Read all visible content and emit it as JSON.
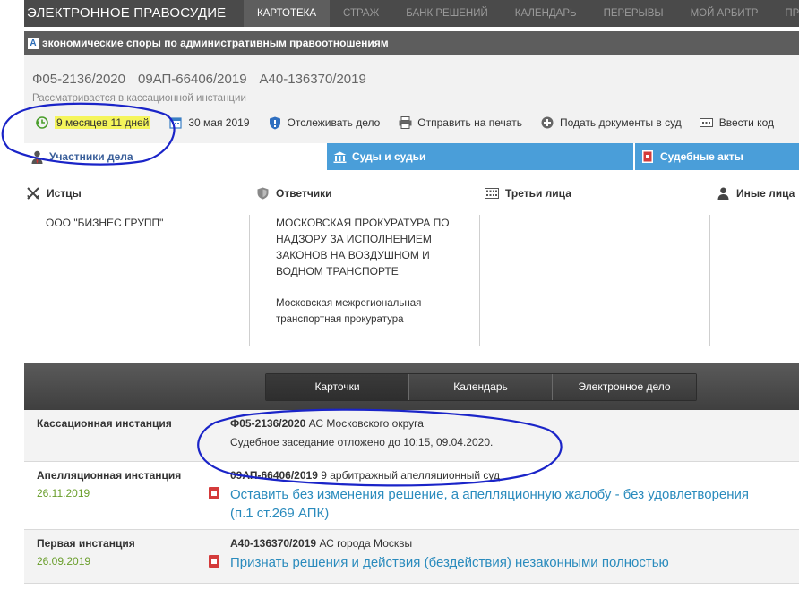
{
  "topbar": {
    "brand": "ЭЛЕКТРОННОЕ ПРАВОСУДИЕ",
    "nav": [
      {
        "label": "КАРТОТЕКА",
        "active": true
      },
      {
        "label": "СТРАЖ",
        "active": false
      },
      {
        "label": "БАНК РЕШЕНИЙ",
        "active": false
      },
      {
        "label": "КАЛЕНДАРЬ",
        "active": false
      },
      {
        "label": "ПЕРЕРЫВЫ",
        "active": false
      },
      {
        "label": "МОЙ АРБИТР",
        "active": false
      },
      {
        "label": "ПРО",
        "active": false
      }
    ]
  },
  "category": {
    "icon_letter": "A",
    "text": "экономические споры по административным правоотношениям"
  },
  "case": {
    "numbers": [
      "Ф05-2136/2020",
      "09АП-66406/2019",
      "А40-136370/2019"
    ],
    "status": "Рассматривается в кассационной инстанции",
    "actions": {
      "duration": "9 месяцев 11 дней",
      "date": "30 мая 2019",
      "track": "Отслеживать дело",
      "print": "Отправить на печать",
      "submit": "Подать документы в суд",
      "code": "Ввести код"
    }
  },
  "tabs": {
    "participants": "Участники дела",
    "courts": "Суды и судьи",
    "acts": "Судебные акты"
  },
  "participants": {
    "plaintiffs": {
      "title": "Истцы",
      "items": [
        "ООО \"БИЗНЕС ГРУПП\""
      ]
    },
    "defendants": {
      "title": "Ответчики",
      "items": [
        [
          "МОСКОВСКАЯ ПРОКУРАТУРА ПО",
          "НАДЗОРУ ЗА ИСПОЛНЕНИЕМ",
          "ЗАКОНОВ НА ВОЗДУШНОМ И",
          "ВОДНОМ ТРАНСПОРТЕ"
        ],
        [
          "Московская межрегиональная",
          "транспортная прокуратура"
        ]
      ]
    },
    "third_parties": {
      "title": "Третьи лица"
    },
    "others": {
      "title": "Иные лица"
    }
  },
  "segments": [
    "Карточки",
    "Календарь",
    "Электронное дело"
  ],
  "instances": [
    {
      "name": "Кассационная инстанция",
      "date": "",
      "case_no": "Ф05-2136/2020",
      "court": "АС Московского округа",
      "note": "Судебное заседание отложено до 10:15, 09.04.2020."
    },
    {
      "name": "Апелляционная инстанция",
      "date": "26.11.2019",
      "case_no": "09АП-66406/2019",
      "court": "9 арбитражный апелляционный суд",
      "link_lines": [
        "Оставить без изменения решение, а апелляционную жалобу - без удовлетворения",
        "(п.1 ст.269 АПК)"
      ]
    },
    {
      "name": "Первая инстанция",
      "date": "26.09.2019",
      "case_no": "А40-136370/2019",
      "court": "АС города Москвы",
      "link_lines": [
        "Признать решения и действия (бездействия) незаконными полностью"
      ]
    }
  ],
  "colors": {
    "topbar": "#4a4a4a",
    "tab_blue": "#4a9ed9",
    "link": "#2a8bbd",
    "date_green": "#6a9e2c",
    "highlight": "#f5f55a",
    "annotation": "#1a24c8"
  }
}
